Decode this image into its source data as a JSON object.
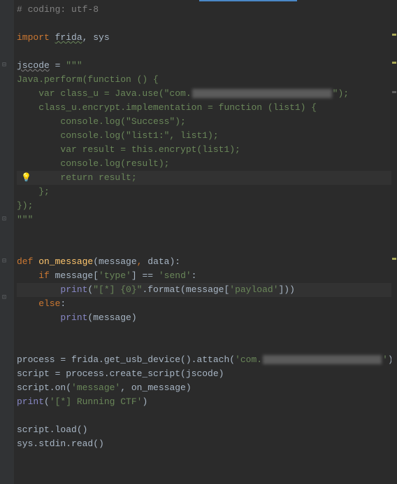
{
  "code": {
    "line1_comment": "# coding: utf-8",
    "line3_import": "import",
    "line3_frida": "frida",
    "line3_sys": " sys",
    "line5_jscode": "jscode",
    "line5_eq": " = ",
    "line5_quote": "\"\"\"",
    "line6": "Java.perform(function () {",
    "line7_pre": "    var class_u = Java.use(\"com.",
    "line7_post": "\");",
    "line8": "    class_u.encrypt.implementation = function (list1) {",
    "line9": "        console.log(\"Success\");",
    "line10": "        console.log(\"list1:\", list1);",
    "line11": "        var result = this.encrypt(list1);",
    "line12": "        console.log(result);",
    "line13": "        return result;",
    "line14": "    };",
    "line15": "});",
    "line16": "\"\"\"",
    "line19_def": "def",
    "line19_fn": " on_message",
    "line19_params_open": "(",
    "line19_p1": "message",
    "line19_comma": ",",
    "line19_p2": " data",
    "line19_params_close": "):",
    "line20_if": "    if",
    "line20_rest": " message[",
    "line20_type": "'type'",
    "line20_mid": "] == ",
    "line20_send": "'send'",
    "line20_colon": ":",
    "line21_print": "        print",
    "line21_open": "(",
    "line21_fmt": "\"[*] {0}\"",
    "line21_format": ".format(message[",
    "line21_payload": "'payload'",
    "line21_close": "]))",
    "line22_else": "    else",
    "line22_colon": ":",
    "line23_print": "        print",
    "line23_args": "(message)",
    "line26_pre": "process = frida.get_usb_device().attach(",
    "line26_str1": "'com.",
    "line26_str2": "'",
    "line26_post": ")",
    "line27": "script = process.create_script(jscode)",
    "line28_pre": "script.on(",
    "line28_msg": "'message'",
    "line28_post": ", on_message)",
    "line29_print": "print",
    "line29_open": "(",
    "line29_str": "'[*] Running CTF'",
    "line29_close": ")",
    "line31": "script.load()",
    "line32": "sys.stdin.read()"
  }
}
